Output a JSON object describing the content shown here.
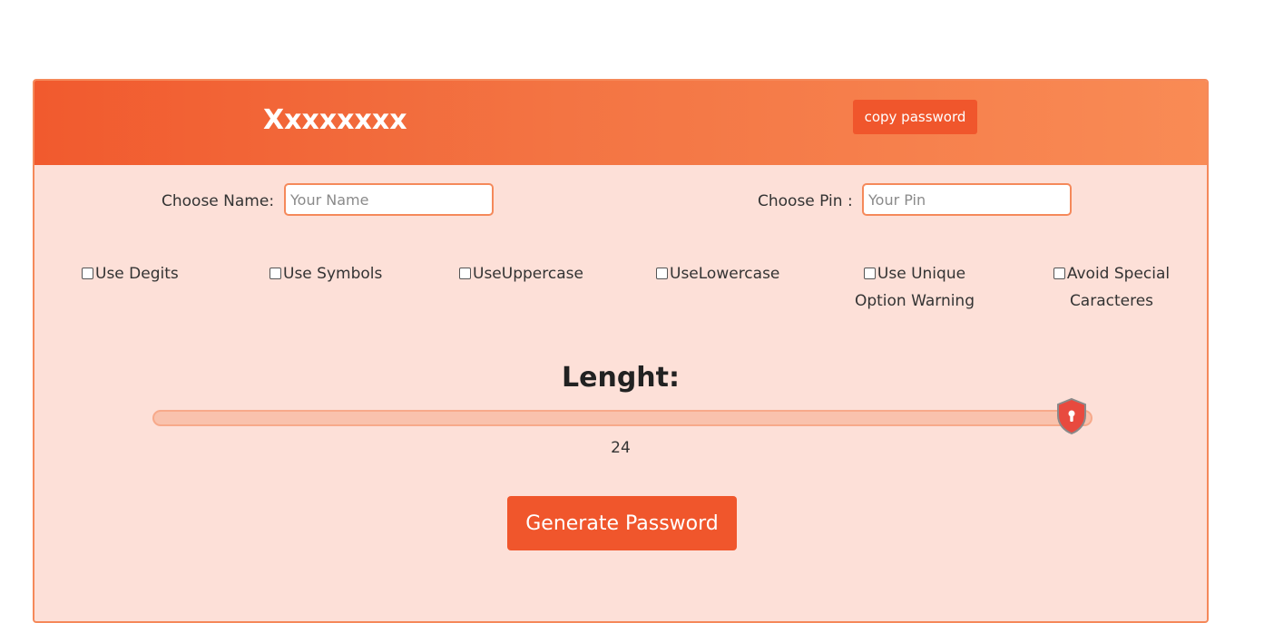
{
  "header": {
    "brand": "Xxxxxxxx",
    "copy_label": "copy password"
  },
  "form": {
    "name_label": "Choose Name:",
    "name_placeholder": "Your Name",
    "name_value": "",
    "pin_label": "Choose Pin :",
    "pin_placeholder": "Your Pin",
    "pin_value": ""
  },
  "options": [
    {
      "line1": "Use Degits",
      "line2": "",
      "checked": false
    },
    {
      "line1": "Use Symbols",
      "line2": "",
      "checked": false
    },
    {
      "line1": "UseUppercase",
      "line2": "",
      "checked": false
    },
    {
      "line1": "UseLowercase",
      "line2": "",
      "checked": false
    },
    {
      "line1": "Use Unique",
      "line2": "Option Warning",
      "checked": false
    },
    {
      "line1": "Avoid Special",
      "line2": "Caracteres",
      "checked": false
    }
  ],
  "length": {
    "title": "Lenght:",
    "value": "24"
  },
  "generate_label": "Generate Password",
  "colors": {
    "accent": "#f0562c",
    "card_bg": "#fde0d8",
    "header_start": "#f15a2e",
    "header_end": "#f98b55",
    "thumb": "#e84a3f"
  },
  "icons": {
    "slider_thumb": "shield-keyhole-icon"
  }
}
